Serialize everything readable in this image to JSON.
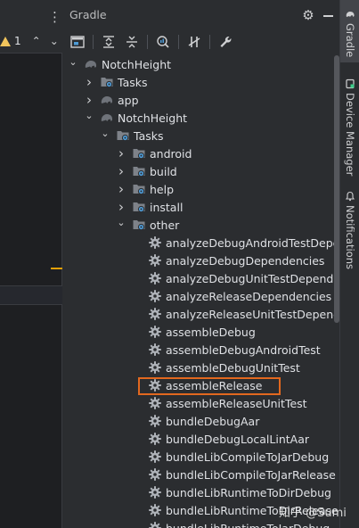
{
  "editor": {
    "warning_count": "1"
  },
  "panel": {
    "title": "Gradle"
  },
  "tree": [
    {
      "label": "NotchHeight",
      "icon": "elephant-icon",
      "chevron": "down",
      "level": 0,
      "name": "tree-root-notchheight"
    },
    {
      "label": "Tasks",
      "icon": "folder-gear-icon",
      "chevron": "right",
      "level": 1,
      "name": "tree-root-tasks"
    },
    {
      "label": "app",
      "icon": "elephant-icon",
      "chevron": "right",
      "level": 1,
      "name": "tree-app"
    },
    {
      "label": "NotchHeight",
      "icon": "elephant-icon",
      "chevron": "down",
      "level": 1,
      "name": "tree-notchheight-module"
    },
    {
      "label": "Tasks",
      "icon": "folder-gear-icon",
      "chevron": "down",
      "level": 2,
      "name": "tree-module-tasks"
    },
    {
      "label": "android",
      "icon": "folder-gear-icon",
      "chevron": "right",
      "level": 3,
      "name": "tree-group-android"
    },
    {
      "label": "build",
      "icon": "folder-gear-icon",
      "chevron": "right",
      "level": 3,
      "name": "tree-group-build"
    },
    {
      "label": "help",
      "icon": "folder-gear-icon",
      "chevron": "right",
      "level": 3,
      "name": "tree-group-help"
    },
    {
      "label": "install",
      "icon": "folder-gear-icon",
      "chevron": "right",
      "level": 3,
      "name": "tree-group-install"
    },
    {
      "label": "other",
      "icon": "folder-gear-icon",
      "chevron": "down",
      "level": 3,
      "name": "tree-group-other"
    },
    {
      "label": "analyzeDebugAndroidTestDependencies",
      "icon": "gear-icon",
      "chevron": "",
      "level": 4,
      "name": "task-item"
    },
    {
      "label": "analyzeDebugDependencies",
      "icon": "gear-icon",
      "chevron": "",
      "level": 4,
      "name": "task-item"
    },
    {
      "label": "analyzeDebugUnitTestDependencies",
      "icon": "gear-icon",
      "chevron": "",
      "level": 4,
      "name": "task-item"
    },
    {
      "label": "analyzeReleaseDependencies",
      "icon": "gear-icon",
      "chevron": "",
      "level": 4,
      "name": "task-item"
    },
    {
      "label": "analyzeReleaseUnitTestDependencies",
      "icon": "gear-icon",
      "chevron": "",
      "level": 4,
      "name": "task-item"
    },
    {
      "label": "assembleDebug",
      "icon": "gear-icon",
      "chevron": "",
      "level": 4,
      "name": "task-item"
    },
    {
      "label": "assembleDebugAndroidTest",
      "icon": "gear-icon",
      "chevron": "",
      "level": 4,
      "name": "task-item"
    },
    {
      "label": "assembleDebugUnitTest",
      "icon": "gear-icon",
      "chevron": "",
      "level": 4,
      "name": "task-item"
    },
    {
      "label": "assembleRelease",
      "icon": "gear-icon",
      "chevron": "",
      "level": 4,
      "name": "task-item-assemble-release"
    },
    {
      "label": "assembleReleaseUnitTest",
      "icon": "gear-icon",
      "chevron": "",
      "level": 4,
      "name": "task-item"
    },
    {
      "label": "bundleDebugAar",
      "icon": "gear-icon",
      "chevron": "",
      "level": 4,
      "name": "task-item"
    },
    {
      "label": "bundleDebugLocalLintAar",
      "icon": "gear-icon",
      "chevron": "",
      "level": 4,
      "name": "task-item"
    },
    {
      "label": "bundleLibCompileToJarDebug",
      "icon": "gear-icon",
      "chevron": "",
      "level": 4,
      "name": "task-item"
    },
    {
      "label": "bundleLibCompileToJarRelease",
      "icon": "gear-icon",
      "chevron": "",
      "level": 4,
      "name": "task-item"
    },
    {
      "label": "bundleLibRuntimeToDirDebug",
      "icon": "gear-icon",
      "chevron": "",
      "level": 4,
      "name": "task-item"
    },
    {
      "label": "bundleLibRuntimeToDirRelease",
      "icon": "gear-icon",
      "chevron": "",
      "level": 4,
      "name": "task-item"
    },
    {
      "label": "bundleLibRuntimeToJarDebug",
      "icon": "gear-icon",
      "chevron": "",
      "level": 4,
      "name": "task-item"
    }
  ],
  "stripe": [
    {
      "label": "Gradle",
      "icon": "elephant-icon",
      "active": true
    },
    {
      "label": "Device Manager",
      "icon": "device-icon",
      "active": false
    },
    {
      "label": "Notifications",
      "icon": "bell-icon",
      "active": false
    }
  ],
  "watermark": "知乎 @Sumi",
  "colors": {
    "highlight_border": "#e2681f",
    "panel_bg": "#2b2d30",
    "editor_bg": "#1e1f22"
  }
}
